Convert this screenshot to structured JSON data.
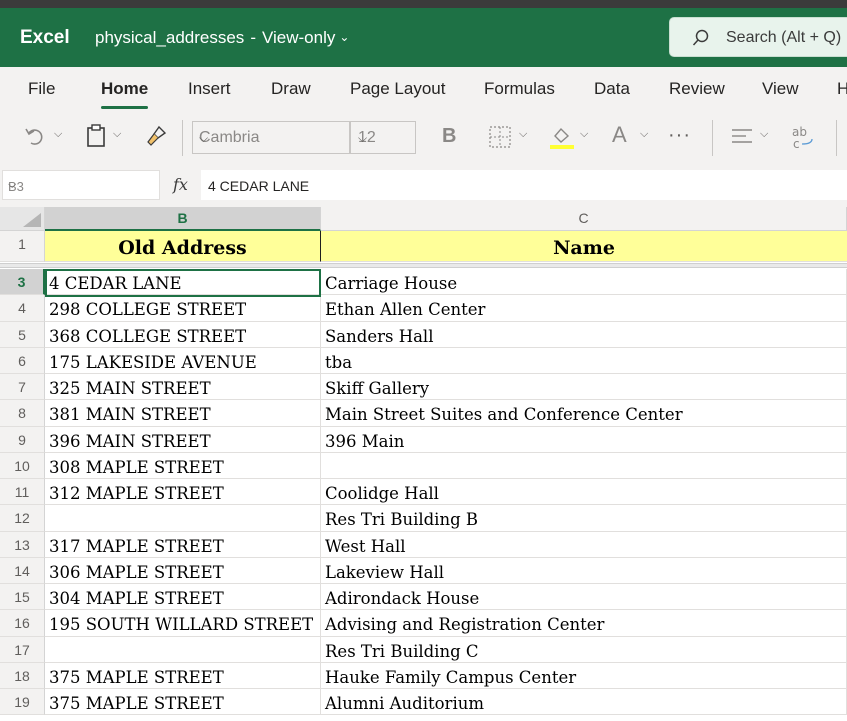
{
  "app": {
    "name": "Excel"
  },
  "document": {
    "title": "physical_addresses",
    "separator": "-",
    "mode": "View-only"
  },
  "search": {
    "placeholder": "Search (Alt + Q)"
  },
  "ribbon_tabs": [
    {
      "label": "File"
    },
    {
      "label": "Home"
    },
    {
      "label": "Insert"
    },
    {
      "label": "Draw"
    },
    {
      "label": "Page Layout"
    },
    {
      "label": "Formulas"
    },
    {
      "label": "Data"
    },
    {
      "label": "Review"
    },
    {
      "label": "View"
    },
    {
      "label": "H"
    }
  ],
  "active_tab": "Home",
  "toolbar": {
    "font_name": "Cambria",
    "font_size": "12",
    "bold_label": "B",
    "font_color_label": "A",
    "more_label": "···"
  },
  "formula_bar": {
    "cell_ref": "B3",
    "fx_label": "fx",
    "formula": "4 CEDAR LANE"
  },
  "columns": [
    {
      "label": "B"
    },
    {
      "label": "C"
    }
  ],
  "header_row": {
    "row_number": "1",
    "b": "Old Address",
    "c": "Name"
  },
  "rows": [
    {
      "num": "3",
      "b": "4 CEDAR LANE",
      "c": "Carriage House"
    },
    {
      "num": "4",
      "b": "298 COLLEGE STREET",
      "c": "Ethan Allen Center"
    },
    {
      "num": "5",
      "b": "368 COLLEGE STREET",
      "c": "Sanders Hall"
    },
    {
      "num": "6",
      "b": "175 LAKESIDE AVENUE",
      "c": "tba"
    },
    {
      "num": "7",
      "b": "325 MAIN STREET",
      "c": "Skiff Gallery"
    },
    {
      "num": "8",
      "b": "381 MAIN STREET",
      "c": "Main Street Suites and Conference Center"
    },
    {
      "num": "9",
      "b": "396 MAIN STREET",
      "c": "396 Main"
    },
    {
      "num": "10",
      "b": "308 MAPLE STREET",
      "c": ""
    },
    {
      "num": "11",
      "b": "312 MAPLE STREET",
      "c": "Coolidge Hall"
    },
    {
      "num": "12",
      "b": "",
      "c": "Res Tri Building B"
    },
    {
      "num": "13",
      "b": "317 MAPLE STREET",
      "c": "West Hall"
    },
    {
      "num": "14",
      "b": "306 MAPLE STREET",
      "c": "Lakeview Hall"
    },
    {
      "num": "15",
      "b": "304 MAPLE STREET",
      "c": "Adirondack House"
    },
    {
      "num": "16",
      "b": "195 SOUTH WILLARD STREET",
      "c": "Advising and Registration Center"
    },
    {
      "num": "17",
      "b": "",
      "c": "Res Tri Building C"
    },
    {
      "num": "18",
      "b": "375 MAPLE STREET",
      "c": "Hauke Family Campus Center"
    },
    {
      "num": "19",
      "b": "375 MAPLE STREET",
      "c": "Alumni Auditorium"
    }
  ],
  "colors": {
    "brand": "#1e7145",
    "header_fill": "#ffff99",
    "selection": "#1e7145"
  }
}
